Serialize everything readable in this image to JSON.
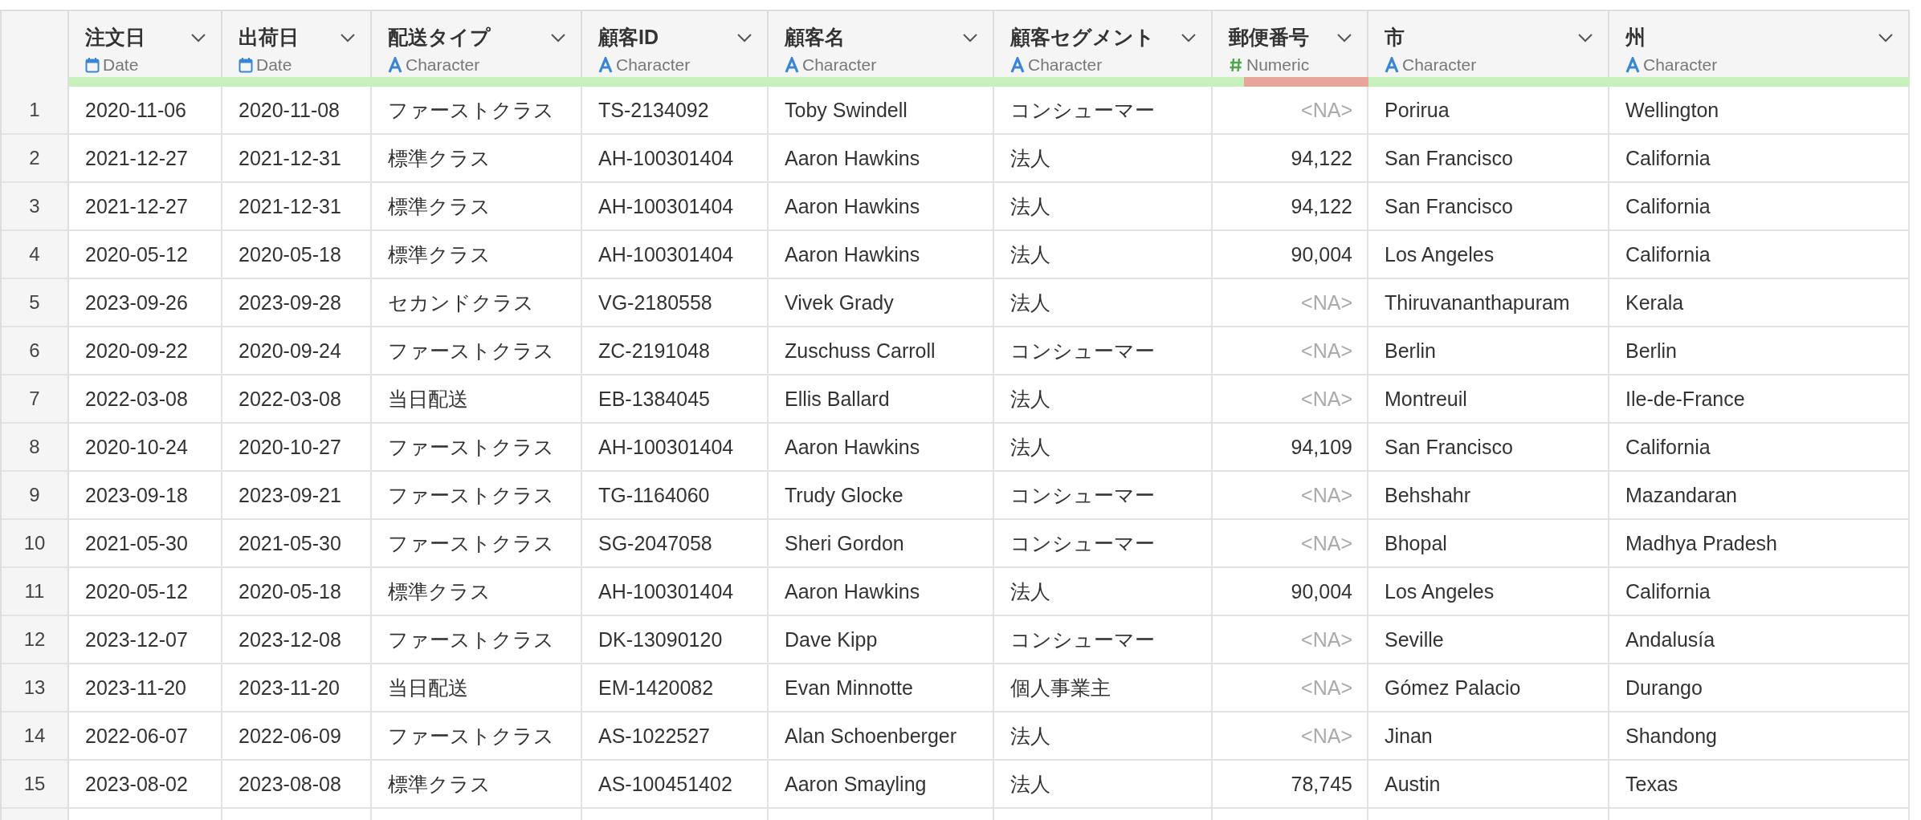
{
  "table": {
    "columns": [
      {
        "name": "注文日",
        "type": "Date",
        "kind": "date",
        "level": 1
      },
      {
        "name": "出荷日",
        "type": "Date",
        "kind": "date",
        "level": 1
      },
      {
        "name": "配送タイプ",
        "type": "Character",
        "kind": "character",
        "level": 1
      },
      {
        "name": "顧客ID",
        "type": "Character",
        "kind": "character",
        "level": 1
      },
      {
        "name": "顧客名",
        "type": "Character",
        "kind": "character",
        "level": 1
      },
      {
        "name": "顧客セグメント",
        "type": "Character",
        "kind": "character",
        "level": 1
      },
      {
        "name": "郵便番号",
        "type": "Numeric",
        "kind": "numeric",
        "level": 0.2
      },
      {
        "name": "市",
        "type": "Character",
        "kind": "character",
        "level": 1
      },
      {
        "name": "州",
        "type": "Character",
        "kind": "character",
        "level": 1
      }
    ],
    "rows": [
      {
        "number": "1",
        "cells": [
          "2020-11-06",
          "2020-11-08",
          "ファーストクラス",
          "TS-2134092",
          "Toby Swindell",
          "コンシューマー",
          {
            "text": "<NA>",
            "missing": true
          },
          "Porirua",
          "Wellington"
        ]
      },
      {
        "number": "2",
        "cells": [
          "2021-12-27",
          "2021-12-31",
          "標準クラス",
          "AH-100301404",
          "Aaron Hawkins",
          "法人",
          {
            "text": "94,122",
            "missing": false
          },
          "San Francisco",
          "California"
        ]
      },
      {
        "number": "3",
        "cells": [
          "2021-12-27",
          "2021-12-31",
          "標準クラス",
          "AH-100301404",
          "Aaron Hawkins",
          "法人",
          {
            "text": "94,122",
            "missing": false
          },
          "San Francisco",
          "California"
        ]
      },
      {
        "number": "4",
        "cells": [
          "2020-05-12",
          "2020-05-18",
          "標準クラス",
          "AH-100301404",
          "Aaron Hawkins",
          "法人",
          {
            "text": "90,004",
            "missing": false
          },
          "Los Angeles",
          "California"
        ]
      },
      {
        "number": "5",
        "cells": [
          "2023-09-26",
          "2023-09-28",
          "セカンドクラス",
          "VG-2180558",
          "Vivek Grady",
          "法人",
          {
            "text": "<NA>",
            "missing": true
          },
          "Thiruvananthapuram",
          "Kerala"
        ]
      },
      {
        "number": "6",
        "cells": [
          "2020-09-22",
          "2020-09-24",
          "ファーストクラス",
          "ZC-2191048",
          "Zuschuss Carroll",
          "コンシューマー",
          {
            "text": "<NA>",
            "missing": true
          },
          "Berlin",
          "Berlin"
        ]
      },
      {
        "number": "7",
        "cells": [
          "2022-03-08",
          "2022-03-08",
          "当日配送",
          "EB-1384045",
          "Ellis Ballard",
          "法人",
          {
            "text": "<NA>",
            "missing": true
          },
          "Montreuil",
          "Ile-de-France"
        ]
      },
      {
        "number": "8",
        "cells": [
          "2020-10-24",
          "2020-10-27",
          "ファーストクラス",
          "AH-100301404",
          "Aaron Hawkins",
          "法人",
          {
            "text": "94,109",
            "missing": false
          },
          "San Francisco",
          "California"
        ]
      },
      {
        "number": "9",
        "cells": [
          "2023-09-18",
          "2023-09-21",
          "ファーストクラス",
          "TG-1164060",
          "Trudy Glocke",
          "コンシューマー",
          {
            "text": "<NA>",
            "missing": true
          },
          "Behshahr",
          "Mazandaran"
        ]
      },
      {
        "number": "10",
        "cells": [
          "2021-05-30",
          "2021-05-30",
          "ファーストクラス",
          "SG-2047058",
          "Sheri Gordon",
          "コンシューマー",
          {
            "text": "<NA>",
            "missing": true
          },
          "Bhopal",
          "Madhya Pradesh"
        ]
      },
      {
        "number": "11",
        "cells": [
          "2020-05-12",
          "2020-05-18",
          "標準クラス",
          "AH-100301404",
          "Aaron Hawkins",
          "法人",
          {
            "text": "90,004",
            "missing": false
          },
          "Los Angeles",
          "California"
        ]
      },
      {
        "number": "12",
        "cells": [
          "2023-12-07",
          "2023-12-08",
          "ファーストクラス",
          "DK-13090120",
          "Dave Kipp",
          "コンシューマー",
          {
            "text": "<NA>",
            "missing": true
          },
          "Seville",
          "Andalusía"
        ]
      },
      {
        "number": "13",
        "cells": [
          "2023-11-20",
          "2023-11-20",
          "当日配送",
          "EM-1420082",
          "Evan Minnotte",
          "個人事業主",
          {
            "text": "<NA>",
            "missing": true
          },
          "Gómez Palacio",
          "Durango"
        ]
      },
      {
        "number": "14",
        "cells": [
          "2022-06-07",
          "2022-06-09",
          "ファーストクラス",
          "AS-1022527",
          "Alan Schoenberger",
          "法人",
          {
            "text": "<NA>",
            "missing": true
          },
          "Jinan",
          "Shandong"
        ]
      },
      {
        "number": "15",
        "cells": [
          "2023-08-02",
          "2023-08-08",
          "標準クラス",
          "AS-100451402",
          "Aaron Smayling",
          "法人",
          {
            "text": "78,745",
            "missing": false
          },
          "Austin",
          "Texas"
        ]
      }
    ]
  }
}
